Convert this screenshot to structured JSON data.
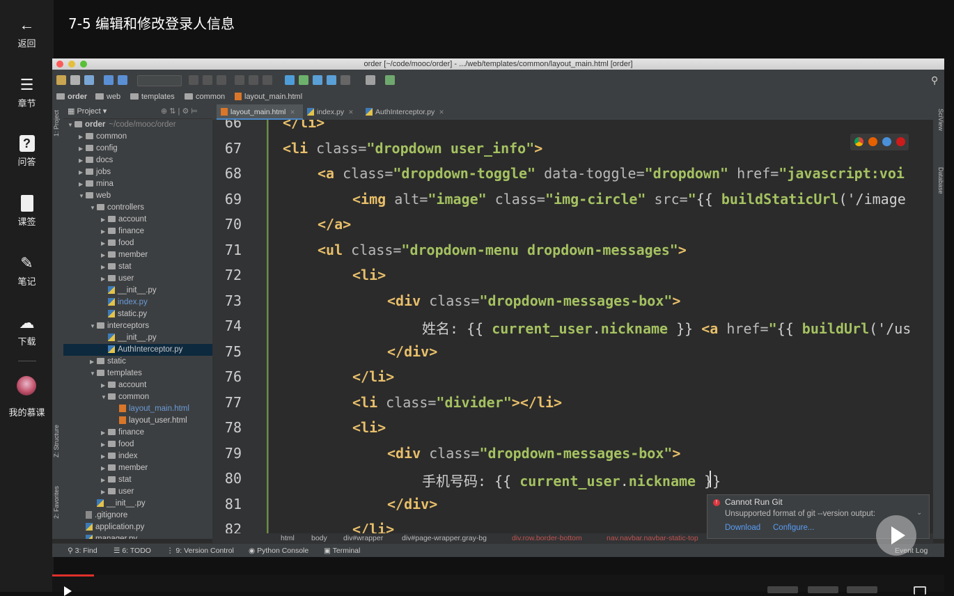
{
  "course": {
    "title": "7-5 编辑和修改登录人信息"
  },
  "left_nav": {
    "back": "返回",
    "chapters": "章节",
    "qa": "问答",
    "lessons": "课签",
    "notes": "笔记",
    "download": "下载",
    "my_courses": "我的慕课"
  },
  "ide": {
    "window_title": "order [~/code/mooc/order] - .../web/templates/common/layout_main.html [order]",
    "breadcrumbs": [
      "order",
      "web",
      "templates",
      "common",
      "layout_main.html"
    ],
    "project_label": "Project",
    "side_left": [
      "1: Project",
      "Z: Structure",
      "2: Favorites"
    ],
    "side_right": [
      "SciView",
      "Database"
    ],
    "tabs": [
      {
        "label": "layout_main.html",
        "active": true
      },
      {
        "label": "index.py",
        "active": false
      },
      {
        "label": "AuthInterceptor.py",
        "active": false
      }
    ],
    "tree": [
      {
        "label": "order",
        "suffix": "~/code/mooc/order",
        "depth": 0,
        "type": "folder",
        "open": true
      },
      {
        "label": "common",
        "depth": 1,
        "type": "folder",
        "open": false
      },
      {
        "label": "config",
        "depth": 1,
        "type": "folder",
        "open": false
      },
      {
        "label": "docs",
        "depth": 1,
        "type": "folder",
        "open": false
      },
      {
        "label": "jobs",
        "depth": 1,
        "type": "folder",
        "open": false
      },
      {
        "label": "mina",
        "depth": 1,
        "type": "folder",
        "open": false
      },
      {
        "label": "web",
        "depth": 1,
        "type": "folder",
        "open": true
      },
      {
        "label": "controllers",
        "depth": 2,
        "type": "folder",
        "open": true
      },
      {
        "label": "account",
        "depth": 3,
        "type": "folder",
        "open": false
      },
      {
        "label": "finance",
        "depth": 3,
        "type": "folder",
        "open": false
      },
      {
        "label": "food",
        "depth": 3,
        "type": "folder",
        "open": false
      },
      {
        "label": "member",
        "depth": 3,
        "type": "folder",
        "open": false
      },
      {
        "label": "stat",
        "depth": 3,
        "type": "folder",
        "open": false
      },
      {
        "label": "user",
        "depth": 3,
        "type": "folder",
        "open": false
      },
      {
        "label": "__init__.py",
        "depth": 3,
        "type": "py"
      },
      {
        "label": "index.py",
        "depth": 3,
        "type": "py",
        "highlight": true
      },
      {
        "label": "static.py",
        "depth": 3,
        "type": "py"
      },
      {
        "label": "interceptors",
        "depth": 2,
        "type": "folder",
        "open": true
      },
      {
        "label": "__init__.py",
        "depth": 3,
        "type": "py"
      },
      {
        "label": "AuthInterceptor.py",
        "depth": 3,
        "type": "py",
        "selected": true
      },
      {
        "label": "static",
        "depth": 2,
        "type": "folder",
        "open": false
      },
      {
        "label": "templates",
        "depth": 2,
        "type": "folder",
        "open": true
      },
      {
        "label": "account",
        "depth": 3,
        "type": "folder",
        "open": false
      },
      {
        "label": "common",
        "depth": 3,
        "type": "folder",
        "open": true
      },
      {
        "label": "layout_main.html",
        "depth": 4,
        "type": "html",
        "highlight": true
      },
      {
        "label": "layout_user.html",
        "depth": 4,
        "type": "html"
      },
      {
        "label": "finance",
        "depth": 3,
        "type": "folder",
        "open": false
      },
      {
        "label": "food",
        "depth": 3,
        "type": "folder",
        "open": false
      },
      {
        "label": "index",
        "depth": 3,
        "type": "folder",
        "open": false
      },
      {
        "label": "member",
        "depth": 3,
        "type": "folder",
        "open": false
      },
      {
        "label": "stat",
        "depth": 3,
        "type": "folder",
        "open": false
      },
      {
        "label": "user",
        "depth": 3,
        "type": "folder",
        "open": false
      },
      {
        "label": "__init__.py",
        "depth": 2,
        "type": "py"
      },
      {
        "label": ".gitignore",
        "depth": 1,
        "type": "file"
      },
      {
        "label": "application.py",
        "depth": 1,
        "type": "py"
      },
      {
        "label": "manager.py",
        "depth": 1,
        "type": "py"
      }
    ],
    "code_lines": [
      {
        "n": "66",
        "indent": 0,
        "tokens": [
          [
            "tg",
            "</li>"
          ]
        ]
      },
      {
        "n": "67",
        "indent": 0,
        "tokens": [
          [
            "tg",
            "<li "
          ],
          [
            "at",
            "class="
          ],
          [
            "st",
            "\"dropdown user_info\""
          ],
          [
            "tg",
            ">"
          ]
        ]
      },
      {
        "n": "68",
        "indent": 1,
        "tokens": [
          [
            "tg",
            "<a "
          ],
          [
            "at",
            "class="
          ],
          [
            "st",
            "\"dropdown-toggle\""
          ],
          [
            "at",
            " data-toggle="
          ],
          [
            "st",
            "\"dropdown\""
          ],
          [
            "at",
            " href="
          ],
          [
            "st",
            "\"javascript:voi"
          ]
        ]
      },
      {
        "n": "69",
        "indent": 2,
        "tokens": [
          [
            "tg",
            "<img "
          ],
          [
            "at",
            "alt="
          ],
          [
            "st",
            "\"image\""
          ],
          [
            "at",
            " class="
          ],
          [
            "st",
            "\"img-circle\""
          ],
          [
            "at",
            " src="
          ],
          [
            "st",
            "\""
          ],
          [
            "ex",
            "{{ "
          ],
          [
            "st",
            "buildStaticUrl"
          ],
          [
            "ex",
            "('/image"
          ]
        ]
      },
      {
        "n": "70",
        "indent": 1,
        "tokens": [
          [
            "tg",
            "</a>"
          ]
        ]
      },
      {
        "n": "71",
        "indent": 1,
        "tokens": [
          [
            "tg",
            "<ul "
          ],
          [
            "at",
            "class="
          ],
          [
            "st",
            "\"dropdown-menu dropdown-messages\""
          ],
          [
            "tg",
            ">"
          ]
        ]
      },
      {
        "n": "72",
        "indent": 2,
        "tokens": [
          [
            "tg",
            "<li>"
          ]
        ]
      },
      {
        "n": "73",
        "indent": 3,
        "tokens": [
          [
            "tg",
            "<div "
          ],
          [
            "at",
            "class="
          ],
          [
            "st",
            "\"dropdown-messages-box\""
          ],
          [
            "tg",
            ">"
          ]
        ]
      },
      {
        "n": "74",
        "indent": 4,
        "tokens": [
          [
            "ex",
            "姓名: {{ "
          ],
          [
            "st",
            "current_user"
          ],
          [
            "ex",
            "."
          ],
          [
            "st",
            "nickname"
          ],
          [
            "ex",
            " }} "
          ],
          [
            "tg",
            "<a "
          ],
          [
            "at",
            "href="
          ],
          [
            "st",
            "\""
          ],
          [
            "ex",
            "{{ "
          ],
          [
            "st",
            "buildUrl"
          ],
          [
            "ex",
            "('/us"
          ]
        ]
      },
      {
        "n": "75",
        "indent": 3,
        "tokens": [
          [
            "tg",
            "</div>"
          ]
        ]
      },
      {
        "n": "76",
        "indent": 2,
        "tokens": [
          [
            "tg",
            "</li>"
          ]
        ]
      },
      {
        "n": "77",
        "indent": 2,
        "tokens": [
          [
            "tg",
            "<li "
          ],
          [
            "at",
            "class="
          ],
          [
            "st",
            "\"divider\""
          ],
          [
            "tg",
            "></li>"
          ]
        ]
      },
      {
        "n": "78",
        "indent": 2,
        "tokens": [
          [
            "tg",
            "<li>"
          ]
        ]
      },
      {
        "n": "79",
        "indent": 3,
        "tokens": [
          [
            "tg",
            "<div "
          ],
          [
            "at",
            "class="
          ],
          [
            "st",
            "\"dropdown-messages-box\""
          ],
          [
            "tg",
            ">"
          ]
        ]
      },
      {
        "n": "80",
        "indent": 4,
        "tokens": [
          [
            "ex",
            "手机号码: {{ "
          ],
          [
            "st",
            "current_user"
          ],
          [
            "ex",
            "."
          ],
          [
            "st",
            "nickname"
          ],
          [
            "ex",
            " }}"
          ]
        ]
      },
      {
        "n": "81",
        "indent": 3,
        "tokens": [
          [
            "tg",
            "</div>"
          ]
        ]
      },
      {
        "n": "82",
        "indent": 2,
        "tokens": [
          [
            "tg",
            "</li>"
          ]
        ]
      }
    ],
    "tag_path": [
      "html",
      "body",
      "div#wrapper",
      "div#page-wrapper.gray-bg",
      "div.row.border-bottom",
      "nav.navbar.navbar-static-top"
    ],
    "bottom_tools": [
      "3: Find",
      "6: TODO",
      "9: Version Control",
      "Python Console",
      "Terminal",
      "Event Log"
    ],
    "notification": {
      "title": "Cannot Run Git",
      "message": "Unsupported format of git --version output:",
      "links": [
        "Download",
        "Configure..."
      ]
    }
  },
  "colors": {
    "accent": "#4a88c7",
    "progress": "#e0302b",
    "error": "#d9363e"
  }
}
